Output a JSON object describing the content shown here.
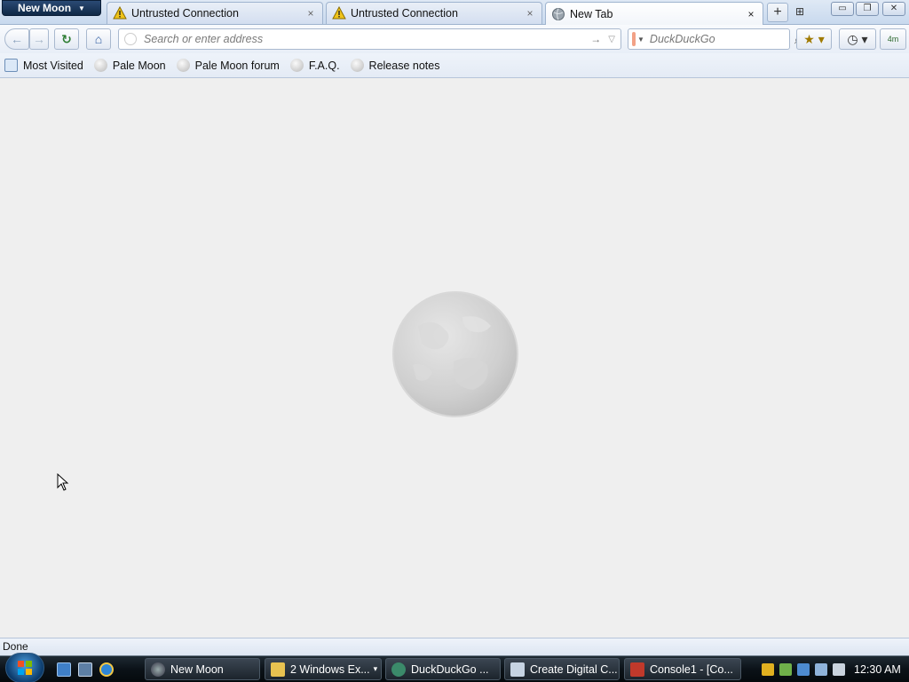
{
  "app_menu": {
    "label": "New Moon"
  },
  "tabs": [
    {
      "label": "Untrusted Connection",
      "icon": "warning-icon",
      "close": "×"
    },
    {
      "label": "Untrusted Connection",
      "icon": "warning-icon",
      "close": "×"
    },
    {
      "label": "New Tab",
      "icon": "globe-icon",
      "close": "×",
      "selected": true
    }
  ],
  "tab_controls": {
    "new_tab": "+",
    "list_all": "⊞"
  },
  "window_controls": {
    "minimize": "▭",
    "maximize": "❐",
    "close": "✕"
  },
  "navbar": {
    "back_icon": "←",
    "forward_icon": "→",
    "reload_icon": "↻",
    "home_icon": "⌂",
    "url_placeholder": "Search or enter address",
    "url_value": "",
    "go_icon": "→",
    "dropdown_icon": "▽",
    "search_placeholder": "DuckDuckGo",
    "search_value": "",
    "search_icon": "⌕",
    "bookmarks_icon": "★ ▾",
    "history_icon": "◷ ▾",
    "status_icon": "4m"
  },
  "bookmarks": [
    {
      "label": "Most Visited",
      "icon": "most-visited-icon"
    },
    {
      "label": "Pale Moon",
      "icon": "moon-icon"
    },
    {
      "label": "Pale Moon forum",
      "icon": "moon-icon"
    },
    {
      "label": "F.A.Q.",
      "icon": "moon-icon"
    },
    {
      "label": "Release notes",
      "icon": "moon-icon"
    }
  ],
  "status": {
    "text": "Done"
  },
  "taskbar": {
    "items": [
      {
        "label": "New Moon"
      },
      {
        "label": "2 Windows Ex...",
        "has_menu": true,
        "caret": "▾"
      },
      {
        "label": "DuckDuckGo ..."
      },
      {
        "label": "Create Digital C..."
      },
      {
        "label": "Console1 - [Co..."
      }
    ],
    "clock": "12:30 AM"
  },
  "colors": {
    "content_bg": "#efefef",
    "accent": "#2c5aa0",
    "taskbar": "#0b1218",
    "warning": "#f0c419",
    "ddg": "#de5833"
  }
}
